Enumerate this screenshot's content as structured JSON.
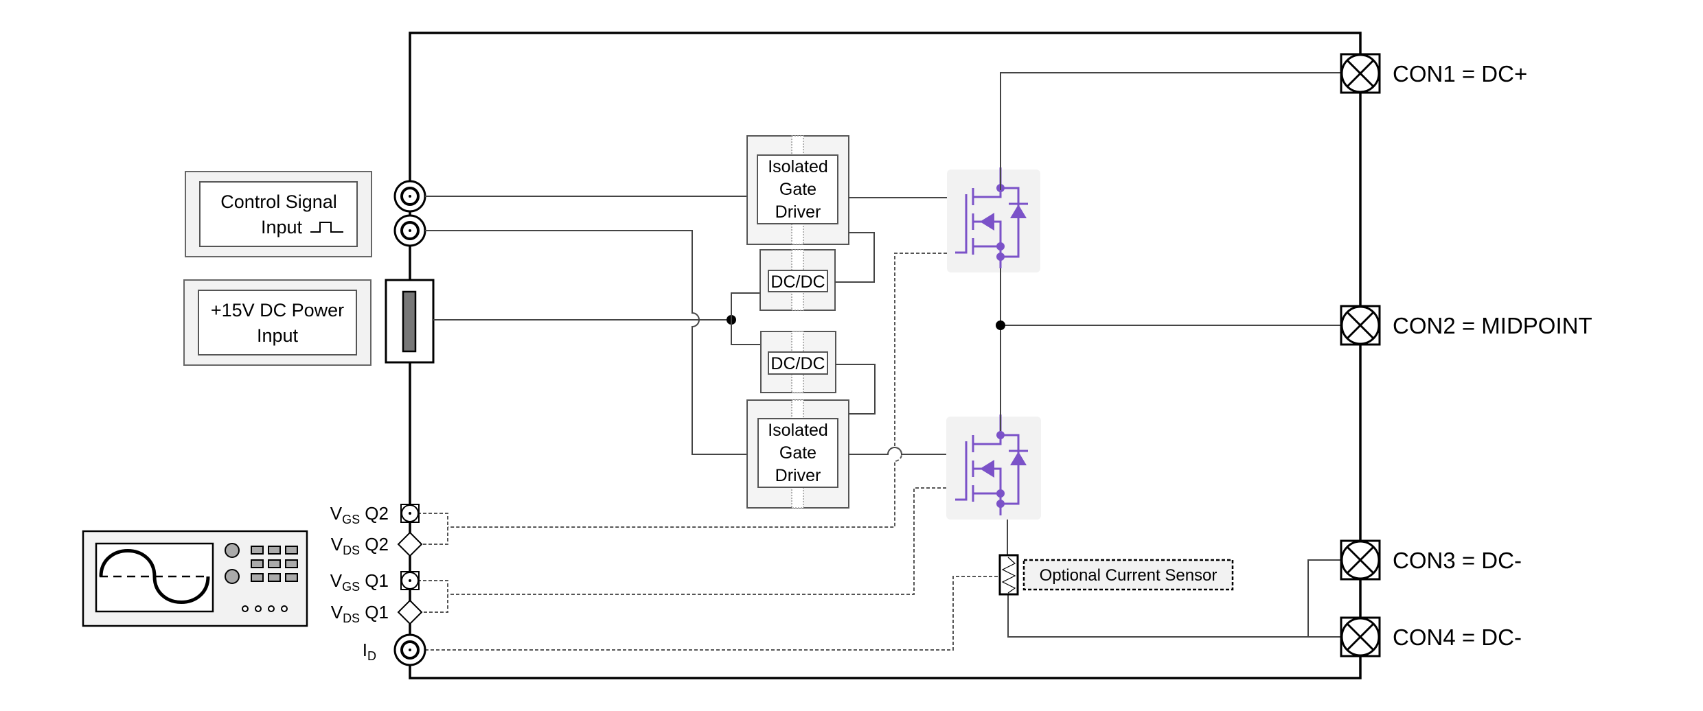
{
  "diagram": {
    "inputs": {
      "control_signal": {
        "line1": "Control Signal",
        "line2": "Input"
      },
      "power": {
        "line1": "+15V DC Power",
        "line2": "Input"
      }
    },
    "blocks": {
      "gate_driver_top": {
        "line1": "Isolated",
        "line2": "Gate",
        "line3": "Driver"
      },
      "gate_driver_bottom": {
        "line1": "Isolated",
        "line2": "Gate",
        "line3": "Driver"
      },
      "dcdc_top": "DC/DC",
      "dcdc_bottom": "DC/DC"
    },
    "connectors": [
      {
        "label": "CON1 = DC+"
      },
      {
        "label": "CON2 = MIDPOINT"
      },
      {
        "label": "CON3 = DC-"
      },
      {
        "label": "CON4 = DC-"
      }
    ],
    "measurements": [
      {
        "main": "V",
        "sub": "GS",
        "suffix": " Q2"
      },
      {
        "main": "V",
        "sub": "DS",
        "suffix": " Q2"
      },
      {
        "main": "V",
        "sub": "GS",
        "suffix": " Q1"
      },
      {
        "main": "V",
        "sub": "DS",
        "suffix": " Q1"
      },
      {
        "main": "I",
        "sub": "D",
        "suffix": ""
      }
    ],
    "current_sensor": "Optional Current Sensor",
    "colors": {
      "mosfet": "#7b52c8",
      "module_bg": "#f2f2f2"
    }
  }
}
